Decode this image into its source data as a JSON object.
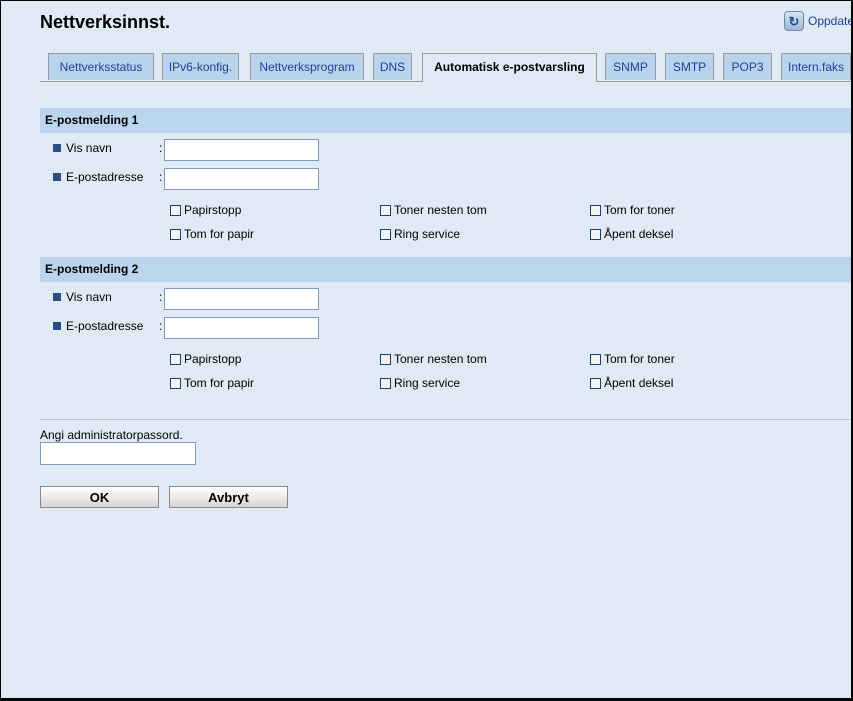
{
  "page": {
    "title": "Nettverksinnst.",
    "refresh_label": "Oppdater"
  },
  "tabs": [
    {
      "label": "Nettverksstatus",
      "active": false
    },
    {
      "label": "IPv6-konfig.",
      "active": false
    },
    {
      "label": "Nettverksprogram",
      "active": false
    },
    {
      "label": "DNS",
      "active": false
    },
    {
      "label": "Automatisk e-postvarsling",
      "active": true
    },
    {
      "label": "SNMP",
      "active": false
    },
    {
      "label": "SMTP",
      "active": false
    },
    {
      "label": "POP3",
      "active": false
    },
    {
      "label": "Intern.faks",
      "active": false
    }
  ],
  "sections": [
    {
      "title": "E-postmelding 1",
      "fields": [
        {
          "label": "Vis navn",
          "value": ""
        },
        {
          "label": "E-postadresse",
          "value": ""
        }
      ],
      "checkboxes": [
        {
          "label": "Papirstopp",
          "checked": false
        },
        {
          "label": "Toner nesten tom",
          "checked": false
        },
        {
          "label": "Tom for toner",
          "checked": false
        },
        {
          "label": "Tom for papir",
          "checked": false
        },
        {
          "label": "Ring service",
          "checked": false
        },
        {
          "label": "Åpent deksel",
          "checked": false
        }
      ]
    },
    {
      "title": "E-postmelding 2",
      "fields": [
        {
          "label": "Vis navn",
          "value": ""
        },
        {
          "label": "E-postadresse",
          "value": ""
        }
      ],
      "checkboxes": [
        {
          "label": "Papirstopp",
          "checked": false
        },
        {
          "label": "Toner nesten tom",
          "checked": false
        },
        {
          "label": "Tom for toner",
          "checked": false
        },
        {
          "label": "Tom for papir",
          "checked": false
        },
        {
          "label": "Ring service",
          "checked": false
        },
        {
          "label": "Åpent deksel",
          "checked": false
        }
      ]
    }
  ],
  "colon": ":",
  "password": {
    "label": "Angi administratorpassord.",
    "value": ""
  },
  "buttons": {
    "ok": "OK",
    "cancel": "Avbryt"
  },
  "colors": {
    "background": "#e0eaf4",
    "tab": "#b9d3ec",
    "section_header": "#bcd5ee",
    "link": "#1f3f9a",
    "bullet": "#2c4c82"
  }
}
